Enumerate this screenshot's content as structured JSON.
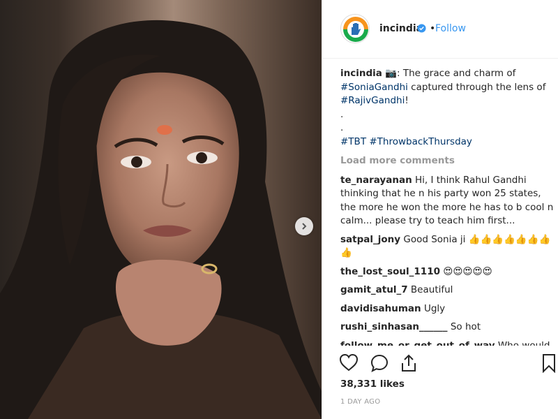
{
  "post": {
    "photo_icon": "photo-portrait",
    "next_icon": "chevron-right-icon"
  },
  "header": {
    "avatar_icon": "congress-hand-logo",
    "username": "incindia",
    "verified_icon": "verified-badge-icon",
    "separator": "•",
    "follow_label": "Follow"
  },
  "caption": {
    "username": "incindia",
    "emoji": "📷",
    "text_before": ": The grace and charm of ",
    "tag1": "#SoniaGandhi",
    "text_mid": " captured through the lens of ",
    "tag2": "#RajivGandhi",
    "text_end": "!",
    "dot1": ".",
    "dot2": ".",
    "tag3": "#TBT",
    "tag4": "#ThrowbackThursday"
  },
  "load_more": "Load more comments",
  "comments": [
    {
      "user": "te_narayanan",
      "text": "Hi, I think Rahul Gandhi thinking that he n his party won 25 states, the more he won the more he has to b cool n calm... please try to teach him first..."
    },
    {
      "user": "satpal_jony",
      "text": "Good Sonia ji 👍👍👍👍👍👍👍👍"
    },
    {
      "user": "the_lost_soul_1110",
      "text": "😍😍😍😍😍"
    },
    {
      "user": "gamit_atul_7",
      "text": "Beautiful"
    },
    {
      "user": "davidisahuman",
      "text": "Ugly"
    },
    {
      "user": "rushi_sinhasan______",
      "text": "So hot"
    },
    {
      "user": "follow_me_or_get_out_of_way",
      "text": "Who would have known then that decades later she will"
    }
  ],
  "actions": {
    "like_icon": "heart-icon",
    "comment_icon": "comment-icon",
    "share_icon": "share-icon",
    "save_icon": "bookmark-icon"
  },
  "likes": "38,331 likes",
  "time_ago": "1 DAY AGO",
  "colors": {
    "link": "#003569",
    "follow": "#3897f0",
    "muted": "#999999",
    "verified": "#3897f0"
  }
}
